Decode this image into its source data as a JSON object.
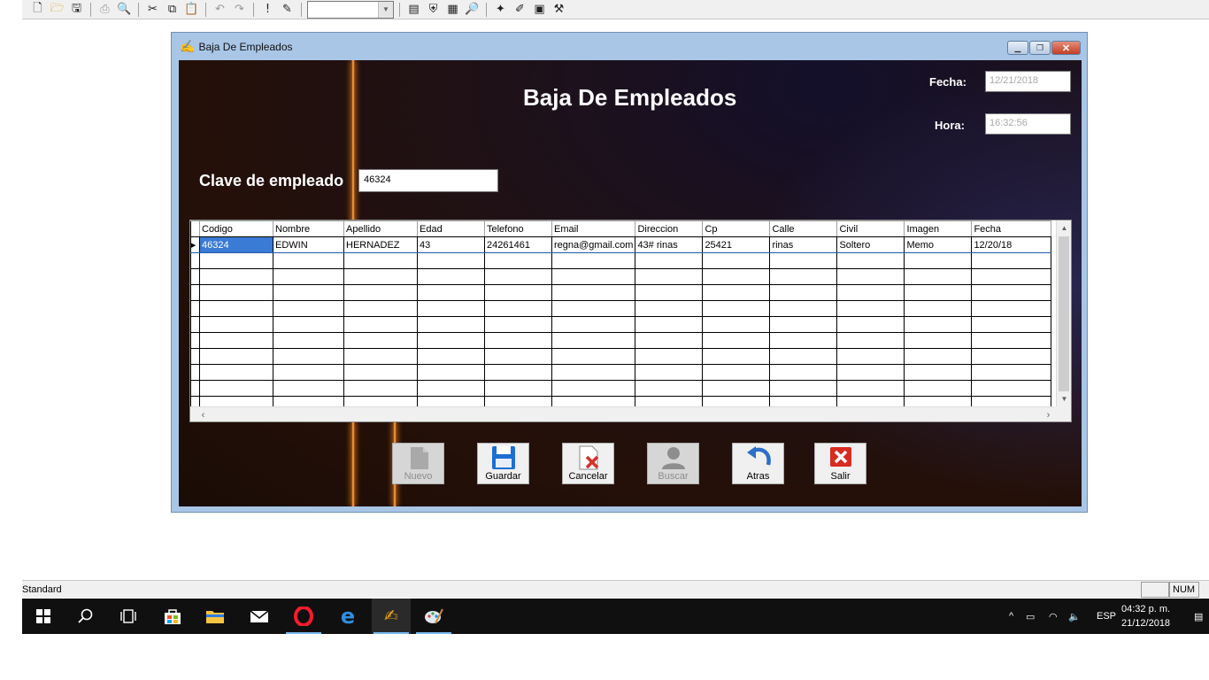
{
  "form": {
    "window_title": "Baja De Empleados",
    "heading": "Baja De Empleados",
    "fecha_label": "Fecha:",
    "fecha_value": "12/21/2018",
    "hora_label": "Hora:",
    "hora_value": "16:32:56",
    "clave_label": "Clave de empleado",
    "clave_value": "46324"
  },
  "grid": {
    "columns": [
      "Codigo",
      "Nombre",
      "Apellido",
      "Edad",
      "Telefono",
      "Email",
      "Direccion",
      "Cp",
      "Calle",
      "Civil",
      "Imagen",
      "Fecha"
    ],
    "rows": [
      [
        "46324",
        "EDWIN",
        "HERNADEZ",
        "43",
        "24261461",
        "regna@gmail.com",
        "43# rinas",
        "25421",
        "rinas",
        "Soltero",
        "Memo",
        "12/20/18"
      ]
    ]
  },
  "buttons": {
    "nuevo": "Nuevo",
    "guardar": "Guardar",
    "cancelar": "Cancelar",
    "buscar": "Buscar",
    "atras": "Atras",
    "salir": "Salir"
  },
  "statusbar": {
    "text": "Standard",
    "num": "NUM"
  },
  "taskbar": {
    "lang": "ESP",
    "time": "04:32 p. m.",
    "date": "21/12/2018"
  },
  "icons": [
    "windows-start-icon",
    "search-icon",
    "task-view-icon",
    "store-icon",
    "file-explorer-icon",
    "mail-icon",
    "opera-icon",
    "edge-icon",
    "vb6-app-icon",
    "paint-icon"
  ]
}
